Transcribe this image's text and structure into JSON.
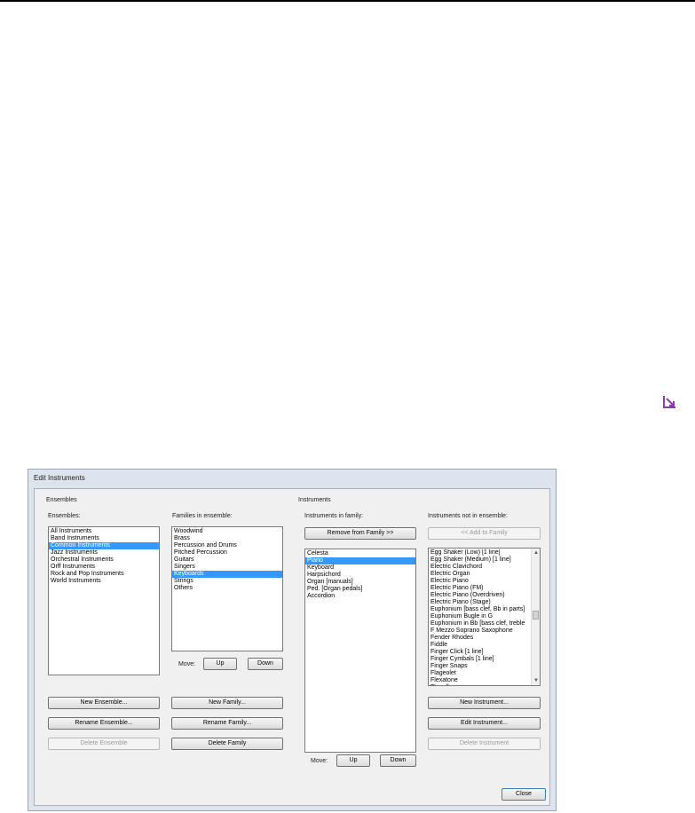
{
  "dialog": {
    "title": "Edit Instruments",
    "close_label": "Close"
  },
  "ensembles_group": {
    "title": "Ensembles",
    "ensembles_label": "Ensembles:",
    "ensembles": [
      {
        "label": "All Instruments",
        "selected": false
      },
      {
        "label": "Band Instruments",
        "selected": false
      },
      {
        "label": "Common Instruments",
        "selected": true
      },
      {
        "label": "Jazz Instruments",
        "selected": false
      },
      {
        "label": "Orchestral Instruments",
        "selected": false
      },
      {
        "label": "Orff Instruments",
        "selected": false
      },
      {
        "label": "Rock and Pop Instruments",
        "selected": false
      },
      {
        "label": "World Instruments",
        "selected": false
      }
    ],
    "families_label": "Families in ensemble:",
    "families": [
      {
        "label": "Woodwind",
        "selected": false
      },
      {
        "label": "Brass",
        "selected": false
      },
      {
        "label": "Percussion and Drums",
        "selected": false
      },
      {
        "label": "Pitched Percussion",
        "selected": false
      },
      {
        "label": "Guitars",
        "selected": false
      },
      {
        "label": "Singers",
        "selected": false
      },
      {
        "label": "Keyboards",
        "selected": true
      },
      {
        "label": "Strings",
        "selected": false
      },
      {
        "label": "Others",
        "selected": false
      }
    ],
    "move_label": "Move:",
    "up_label": "Up",
    "down_label": "Down",
    "new_ensemble": "New Ensemble...",
    "rename_ensemble": "Rename Ensemble...",
    "delete_ensemble": "Delete Ensemble",
    "new_family": "New Family...",
    "rename_family": "Rename Family...",
    "delete_family": "Delete Family"
  },
  "instruments_group": {
    "title": "Instruments",
    "in_family_label": "Instruments in family:",
    "remove_from_family": "Remove from Family >>",
    "in_family": [
      {
        "label": "Celesta",
        "selected": false
      },
      {
        "label": "Piano",
        "selected": true
      },
      {
        "label": "Keyboard",
        "selected": false
      },
      {
        "label": "Harpsichord",
        "selected": false
      },
      {
        "label": "Organ [manuals]",
        "selected": false
      },
      {
        "label": "Ped. [Organ pedals]",
        "selected": false
      },
      {
        "label": "Accordion",
        "selected": false
      }
    ],
    "move_label": "Move:",
    "up_label": "Up",
    "down_label": "Down",
    "not_in_ensemble_label": "Instruments not in ensemble:",
    "add_to_family": "<< Add to Family",
    "not_in_ensemble": [
      {
        "label": "Egg Shaker (Low) [1 line]"
      },
      {
        "label": "Egg Shaker (Medium) [1 line]"
      },
      {
        "label": "Electric Clavichord"
      },
      {
        "label": "Electric Organ"
      },
      {
        "label": "Electric Piano"
      },
      {
        "label": "Electric Piano (FM)"
      },
      {
        "label": "Electric Piano (Overdriven)"
      },
      {
        "label": "Electric Piano (Stage)"
      },
      {
        "label": "Euphonium [bass clef, Bb in parts]"
      },
      {
        "label": "Euphonium Bugle in G"
      },
      {
        "label": "Euphonium in Bb [bass clef, treble"
      },
      {
        "label": "F Mezzo Soprano Saxophone"
      },
      {
        "label": "Fender Rhodes"
      },
      {
        "label": "Fiddle"
      },
      {
        "label": "Finger Click [1 line]"
      },
      {
        "label": "Finger Cymbals [1 line]"
      },
      {
        "label": "Finger Snaps"
      },
      {
        "label": "Flageolet"
      },
      {
        "label": "Flexatone"
      },
      {
        "label": "Flugelhorn"
      }
    ],
    "new_instrument": "New Instrument...",
    "edit_instrument": "Edit Instrument...",
    "delete_instrument": "Delete Instrument"
  },
  "icons": {
    "corner": "resize-corner-icon",
    "corner_color": "#8a3fb0"
  }
}
